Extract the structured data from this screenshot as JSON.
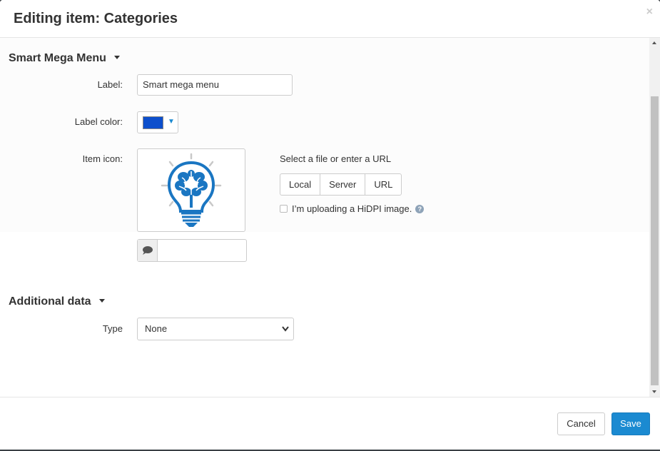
{
  "dialog": {
    "title": "Editing item: Categories",
    "close_icon": "close-icon"
  },
  "smart_mega_menu": {
    "heading": "Smart Mega Menu",
    "label_caption": "Label:",
    "label_value": "Smart mega menu",
    "label_color_caption": "Label color:",
    "label_color_value": "#0d4fcc",
    "item_icon_caption": "Item icon:",
    "icon_image": "lightbulb-brain-icon",
    "icon_alt_value": "",
    "upload_hint": "Select a file or enter a URL",
    "upload_buttons": [
      "Local",
      "Server",
      "URL"
    ],
    "hidpi_label": "I’m uploading a HiDPI image.",
    "hidpi_checked": false
  },
  "additional_data": {
    "heading": "Additional data",
    "type_caption": "Type",
    "type_value": "None"
  },
  "footer": {
    "cancel_label": "Cancel",
    "save_label": "Save"
  },
  "colors": {
    "accent": "#1b8ad1",
    "icon_blue": "#1a76c2"
  }
}
